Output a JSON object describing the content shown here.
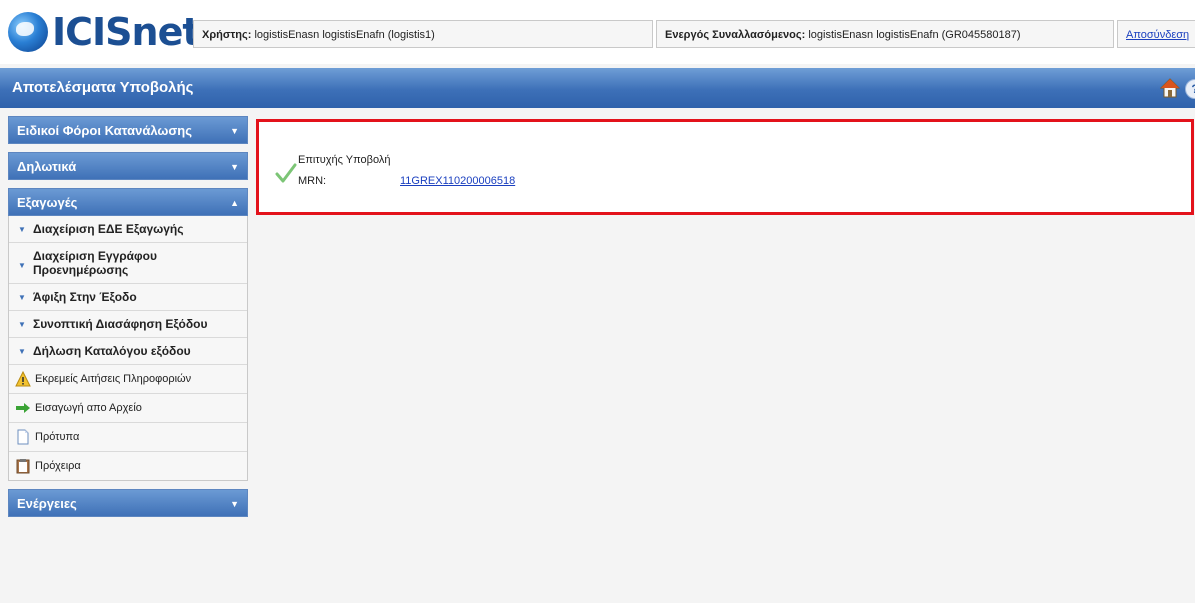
{
  "app": {
    "logo_text": "ICISnet"
  },
  "header": {
    "user_label": "Χρήστης:",
    "user_value": "logistisEnasn logistisEnafn (logistis1)",
    "trader_label": "Ενεργός Συναλλασόμενος:",
    "trader_value": "logistisEnasn logistisEnafn (GR045580187)",
    "logout_label": "Αποσύνδεση"
  },
  "titlebar": {
    "title": "Αποτελέσματα Υποβολής",
    "help_label": "?"
  },
  "sidebar": {
    "sections": [
      {
        "label": "Ειδικοί Φόροι Κατανάλωσης",
        "chevron": "▼"
      },
      {
        "label": "Δηλωτικά",
        "chevron": "▼"
      },
      {
        "label": "Εξαγωγές",
        "chevron": "▲"
      },
      {
        "label": "Ενέργειες",
        "chevron": "▼"
      }
    ],
    "export_items": [
      "Διαχείριση ΕΔΕ Εξαγωγής",
      "Διαχείριση Εγγράφου Προενημέρωσης",
      "Άφιξη Στην Έξοδο",
      "Συνοπτική Διασάφηση Εξόδου",
      "Δήλωση Καταλόγου εξόδου"
    ],
    "export_tools": [
      {
        "label": "Εκρεμείς Αιτήσεις Πληροφοριών",
        "icon": "warning-icon"
      },
      {
        "label": "Εισαγωγή απο Αρχείο",
        "icon": "green-arrow-icon"
      },
      {
        "label": "Πρότυπα",
        "icon": "document-icon"
      },
      {
        "label": "Πρόχειρα",
        "icon": "clipboard-icon"
      }
    ]
  },
  "result": {
    "status": "Επιτυχής Υποβολή",
    "mrn_label": "MRN:",
    "mrn_value": "11GREX110200006518"
  },
  "colors": {
    "accent": "#3d70b8",
    "highlight_border": "#e3121b",
    "link": "#1a3fbf",
    "success": "#7cc576"
  }
}
